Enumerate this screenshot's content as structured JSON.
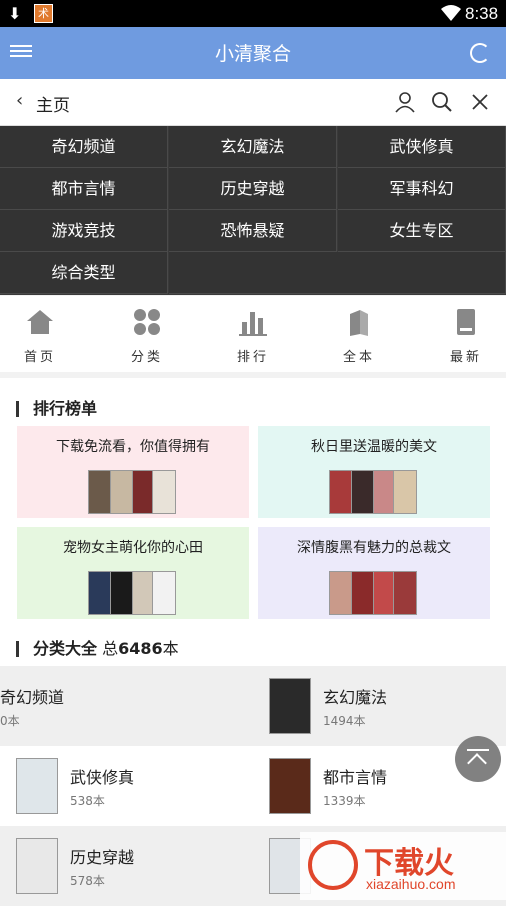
{
  "status": {
    "time": "8:38"
  },
  "header": {
    "title": "小清聚合"
  },
  "nav": {
    "back_label": "主页"
  },
  "categories": [
    "奇幻频道",
    "玄幻魔法",
    "武侠修真",
    "都市言情",
    "历史穿越",
    "军事科幻",
    "游戏竞技",
    "恐怖悬疑",
    "女生专区",
    "综合类型"
  ],
  "tabs": [
    {
      "label": "首页",
      "icon": "home-icon"
    },
    {
      "label": "分类",
      "icon": "grid-icon"
    },
    {
      "label": "排行",
      "icon": "bar-chart-icon"
    },
    {
      "label": "全本",
      "icon": "books-icon"
    },
    {
      "label": "最新",
      "icon": "book-icon"
    }
  ],
  "ranking": {
    "title": "排行榜单",
    "cards": [
      {
        "title": "下载免流看，你值得拥有",
        "bg": "#fde9ec"
      },
      {
        "title": "秋日里送温暖的美文",
        "bg": "#e3f7f3"
      },
      {
        "title": "宠物女主萌化你的心田",
        "bg": "#e6f7e0"
      },
      {
        "title": "深情腹黑有魅力的总裁文",
        "bg": "#eceafa"
      }
    ]
  },
  "catsection": {
    "title": "分类大全",
    "total_prefix": "总",
    "total": "6486",
    "total_suffix": "本"
  },
  "catlist": [
    {
      "name": "奇幻频道",
      "count": "0本"
    },
    {
      "name": "玄幻魔法",
      "count": "1494本"
    },
    {
      "name": "武侠修真",
      "count": "538本"
    },
    {
      "name": "都市言情",
      "count": "1339本"
    },
    {
      "name": "历史穿越",
      "count": "578本"
    },
    {
      "name": "",
      "count": ""
    }
  ],
  "watermark": {
    "text": "下载火",
    "url": "xiazaihuo.com"
  }
}
